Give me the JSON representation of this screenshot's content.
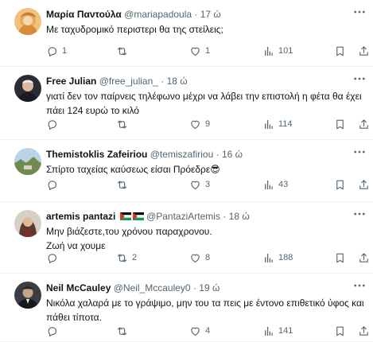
{
  "tweets": [
    {
      "name": "Μαρία Παντούλα",
      "handle": "@mariapadoula",
      "time": "17 ώ",
      "text": [
        "Με ταχυδρομικό περιστερι θα της στείλεις;"
      ],
      "replies": "1",
      "retweets": "",
      "likes": "1",
      "views": "101"
    },
    {
      "name": "Free Julian",
      "handle": "@free_julian_",
      "time": "18 ώ",
      "text": [
        "γιατί δεν τον παίρνεις τηλέφωνο μέχρι  να λάβει την επιστολή η φέτα θα έχει",
        "πάει 124 ευρώ το κιλό"
      ],
      "replies": "",
      "retweets": "",
      "likes": "9",
      "views": "114"
    },
    {
      "name": "Themistoklis Zafeiriou",
      "handle": "@temiszafiriou",
      "time": "16 ώ",
      "text": [
        "Σπίρτο ταχείας καύσεως είσαι Πρόεδρε😎"
      ],
      "replies": "",
      "retweets": "",
      "likes": "3",
      "views": "43"
    },
    {
      "name": "artemis pantazi",
      "handle": "@PantaziArtemis",
      "time": "18 ώ",
      "text": [
        "Μην βιάζεστε,του χρόνου παραχρονου.",
        "Ζωή να χουμε"
      ],
      "replies": "",
      "retweets": "2",
      "likes": "8",
      "views": "188"
    },
    {
      "name": "Neil McCauley",
      "handle": "@Neil_Mccauley0",
      "time": "19 ώ",
      "text": [
        "Νικόλα χαλαρά με το γράψιμο, μην του τα πεις με έντονο επιθετικό ύφος και",
        "πάθει τίποτα."
      ],
      "replies": "",
      "retweets": "",
      "likes": "4",
      "views": "141"
    }
  ],
  "separator": "·",
  "icons": [
    "reply-icon",
    "retweet-icon",
    "like-icon",
    "views-icon",
    "bookmark-icon",
    "share-icon",
    "more-icon"
  ],
  "colors": {
    "text": "#0f1419",
    "secondary": "#536471",
    "border": "#eff3f4"
  }
}
